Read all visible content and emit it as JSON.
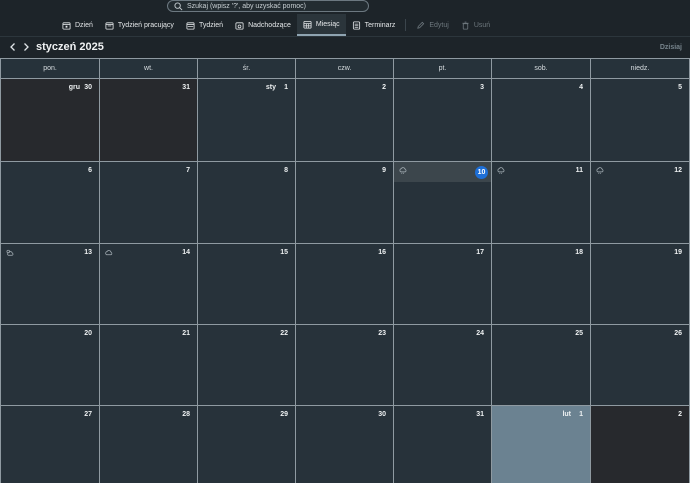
{
  "search": {
    "placeholder": "Szukaj (wpisz '?', aby uzyskać pomoc)"
  },
  "toolbar": {
    "items": [
      {
        "label": "Dzień",
        "icon": "calendar-day-icon"
      },
      {
        "label": "Tydzień pracujący",
        "icon": "calendar-workweek-icon"
      },
      {
        "label": "Tydzień",
        "icon": "calendar-week-icon"
      },
      {
        "label": "Nadchodzące",
        "icon": "calendar-upcoming-icon"
      },
      {
        "label": "Miesiąc",
        "icon": "calendar-month-icon",
        "active": true
      },
      {
        "label": "Terminarz",
        "icon": "agenda-icon"
      },
      {
        "label": "Edytuj",
        "icon": "edit-icon",
        "disabled": true
      },
      {
        "label": "Usuń",
        "icon": "trash-icon",
        "disabled": true
      }
    ]
  },
  "nav": {
    "title": "styczeń 2025",
    "today_label": "Dzisiaj"
  },
  "weekdays": [
    "pon.",
    "wt.",
    "śr.",
    "czw.",
    "pt.",
    "sob.",
    "niedz."
  ],
  "weeks": [
    [
      {
        "day": "30",
        "month_label": "gru",
        "outside": true
      },
      {
        "day": "31",
        "outside": true
      },
      {
        "day": "1",
        "month_label": "sty"
      },
      {
        "day": "2"
      },
      {
        "day": "3"
      },
      {
        "day": "4"
      },
      {
        "day": "5"
      }
    ],
    [
      {
        "day": "6"
      },
      {
        "day": "7"
      },
      {
        "day": "8"
      },
      {
        "day": "9"
      },
      {
        "day": "10",
        "today": true,
        "weather": "rain-cloud-icon"
      },
      {
        "day": "11",
        "weather": "rain-cloud-icon"
      },
      {
        "day": "12",
        "weather": "rain-cloud-icon"
      }
    ],
    [
      {
        "day": "13",
        "weather": "partly-cloudy-icon"
      },
      {
        "day": "14",
        "weather": "cloud-icon"
      },
      {
        "day": "15"
      },
      {
        "day": "16"
      },
      {
        "day": "17"
      },
      {
        "day": "18"
      },
      {
        "day": "19"
      }
    ],
    [
      {
        "day": "20"
      },
      {
        "day": "21"
      },
      {
        "day": "22"
      },
      {
        "day": "23"
      },
      {
        "day": "24"
      },
      {
        "day": "25"
      },
      {
        "day": "26"
      }
    ],
    [
      {
        "day": "27"
      },
      {
        "day": "28"
      },
      {
        "day": "29"
      },
      {
        "day": "30"
      },
      {
        "day": "31"
      },
      {
        "day": "1",
        "month_label": "lut",
        "highlight": true
      },
      {
        "day": "2",
        "outside": true
      }
    ]
  ]
}
